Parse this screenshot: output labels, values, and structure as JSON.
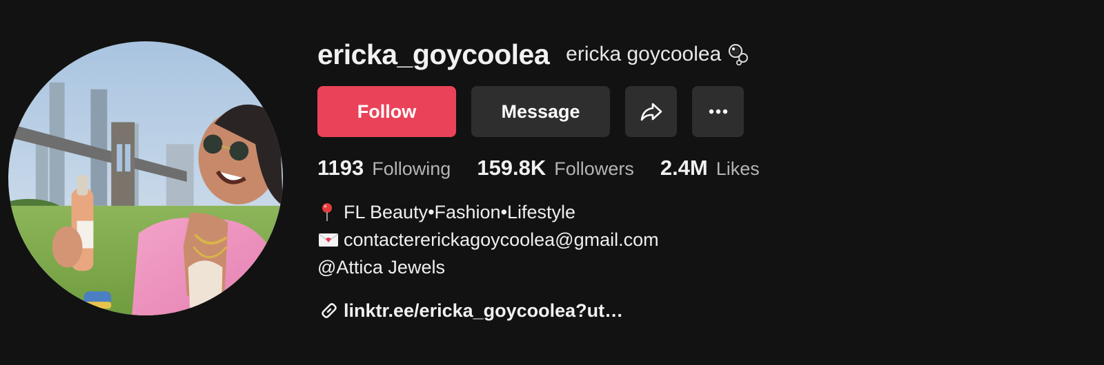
{
  "profile": {
    "avatar_icon": "profile-photo",
    "username": "ericka_goycoolea",
    "nickname": "ericka goycoolea",
    "nickname_emoji_icon": "bubbles-icon",
    "colors": {
      "background": "#121212",
      "follow_button": "#ea4359",
      "secondary_button": "#2e2e2e",
      "stat_label": "#b5b5b5"
    }
  },
  "actions": {
    "follow_label": "Follow",
    "message_label": "Message",
    "share_icon": "share-icon",
    "more_icon": "more-icon"
  },
  "stats": {
    "following_count": "1193",
    "following_label": "Following",
    "followers_count": "159.8K",
    "followers_label": "Followers",
    "likes_count": "2.4M",
    "likes_label": "Likes"
  },
  "bio": {
    "line1_icon": "pushpin-icon",
    "line1": "FL Beauty•Fashion•Lifestyle",
    "line2_icon": "envelope-icon",
    "line2": "contactererickagoycoolea@gmail.com",
    "line3": "@Attica Jewels"
  },
  "link": {
    "icon": "link-icon",
    "text": "linktr.ee/ericka_goycoolea?ut…"
  }
}
